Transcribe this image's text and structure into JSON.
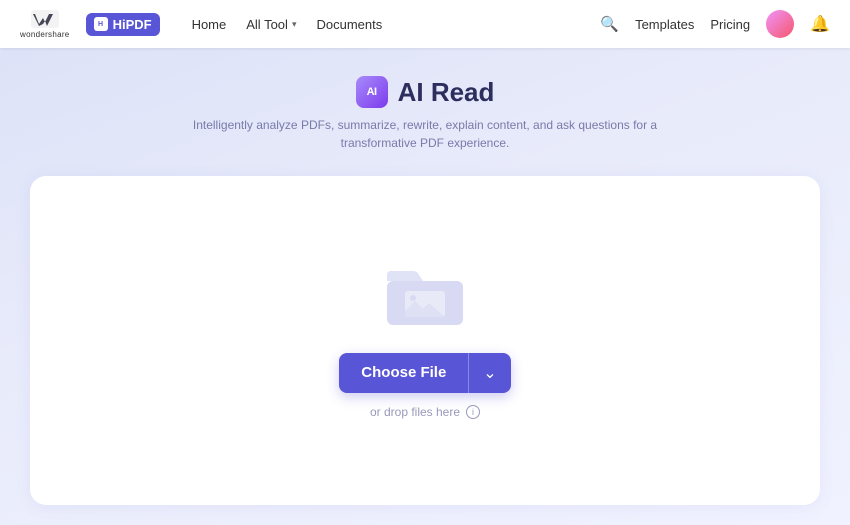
{
  "navbar": {
    "wondershare_logo_text": "wondershare",
    "hipdf_label": "HiPDF",
    "nav_links": [
      {
        "label": "Home",
        "has_dropdown": false
      },
      {
        "label": "All Tool",
        "has_dropdown": true
      },
      {
        "label": "Documents",
        "has_dropdown": false
      }
    ],
    "search_tooltip": "Search",
    "right_links": [
      {
        "label": "Templates"
      },
      {
        "label": "Pricing"
      }
    ],
    "bell_tooltip": "Notifications"
  },
  "page": {
    "ai_badge_label": "AI",
    "title": "AI Read",
    "subtitle": "Intelligently analyze PDFs, summarize, rewrite, explain content, and ask questions for a transformative PDF experience.",
    "choose_file_label": "Choose File",
    "drop_text": "or drop files here",
    "info_icon_label": "ⓘ"
  }
}
